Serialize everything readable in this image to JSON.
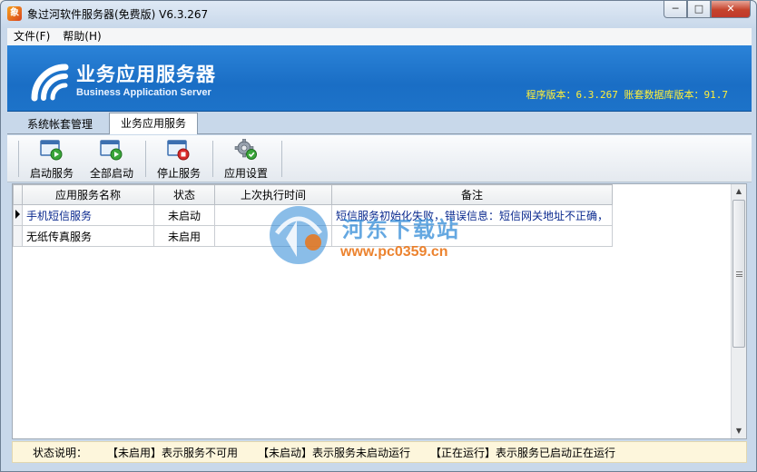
{
  "window": {
    "title": "象过河软件服务器(免费版) V6.3.267",
    "controls": {
      "minimize": "─",
      "maximize": "□",
      "close": "✕"
    }
  },
  "menu": [
    "文件(F)",
    "帮助(H)"
  ],
  "banner": {
    "title_cn": "业务应用服务器",
    "title_en": "Business Application Server",
    "version_text": "程序版本：6.3.267  账套数据库版本：91.7"
  },
  "tabs": [
    {
      "label": "系统帐套管理",
      "active": false
    },
    {
      "label": "业务应用服务",
      "active": true
    }
  ],
  "toolbar": [
    {
      "label": "启动服务",
      "icon": "start-service-icon"
    },
    {
      "label": "全部启动",
      "icon": "start-all-icon"
    },
    {
      "label": "停止服务",
      "icon": "stop-service-icon"
    },
    {
      "label": "应用设置",
      "icon": "settings-gear-icon"
    }
  ],
  "grid": {
    "columns": [
      "应用服务名称",
      "状态",
      "上次执行时间",
      "备注"
    ],
    "rows": [
      {
        "name": "手机短信服务",
        "status": "未启动",
        "last_run": "",
        "note": "短信服务初始化失败，错误信息：短信网关地址不正确，",
        "selected": true
      },
      {
        "name": "无纸传真服务",
        "status": "未启用",
        "last_run": "",
        "note": "",
        "selected": false
      }
    ]
  },
  "watermark": {
    "text": "河东下载站",
    "url": "www.pc0359.cn"
  },
  "status_legend": {
    "label": "状态说明：",
    "items": [
      "【未启用】表示服务不可用",
      "【未启动】表示服务未启动运行",
      "【正在运行】表示服务已启动正在运行"
    ]
  },
  "colors": {
    "banner": "#1d73c9",
    "version_text": "#ffef3a",
    "link_text": "#0b2a8f"
  }
}
